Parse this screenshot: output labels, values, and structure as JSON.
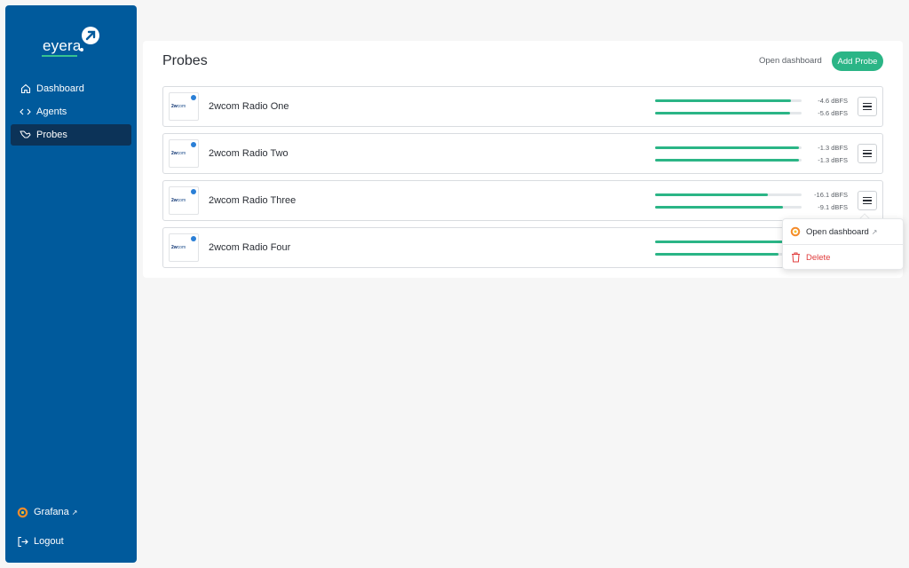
{
  "sidebar": {
    "logo_text": "eyera",
    "nav": [
      {
        "label": "Dashboard",
        "icon": "home-icon"
      },
      {
        "label": "Agents",
        "icon": "code-icon"
      },
      {
        "label": "Probes",
        "icon": "probe-icon"
      }
    ],
    "grafana_label": "Grafana",
    "logout_label": "Logout"
  },
  "main": {
    "title": "Probes",
    "open_dashboard_label": "Open dashboard",
    "add_probe_label": "Add Probe",
    "probes": [
      {
        "name": "2wcom Radio One",
        "levels": [
          {
            "label": "-4.6 dBFS",
            "fill": 0.93
          },
          {
            "label": "-5.6 dBFS",
            "fill": 0.92
          }
        ]
      },
      {
        "name": "2wcom Radio Two",
        "levels": [
          {
            "label": "-1.3 dBFS",
            "fill": 0.98
          },
          {
            "label": "-1.3 dBFS",
            "fill": 0.98
          }
        ]
      },
      {
        "name": "2wcom Radio Three",
        "levels": [
          {
            "label": "-16.1 dBFS",
            "fill": 0.77
          },
          {
            "label": "-9.1 dBFS",
            "fill": 0.87
          }
        ]
      },
      {
        "name": "2wcom Radio Four",
        "levels": [
          {
            "fill": 0.87
          },
          {
            "fill": 0.84
          }
        ]
      }
    ],
    "thumb_text": "2wcom"
  },
  "dropdown": {
    "open_dashboard_label": "Open dashboard",
    "delete_label": "Delete"
  },
  "colors": {
    "sidebar": "#005a9c",
    "accent": "#2bb586",
    "delete": "#e03b3b"
  }
}
